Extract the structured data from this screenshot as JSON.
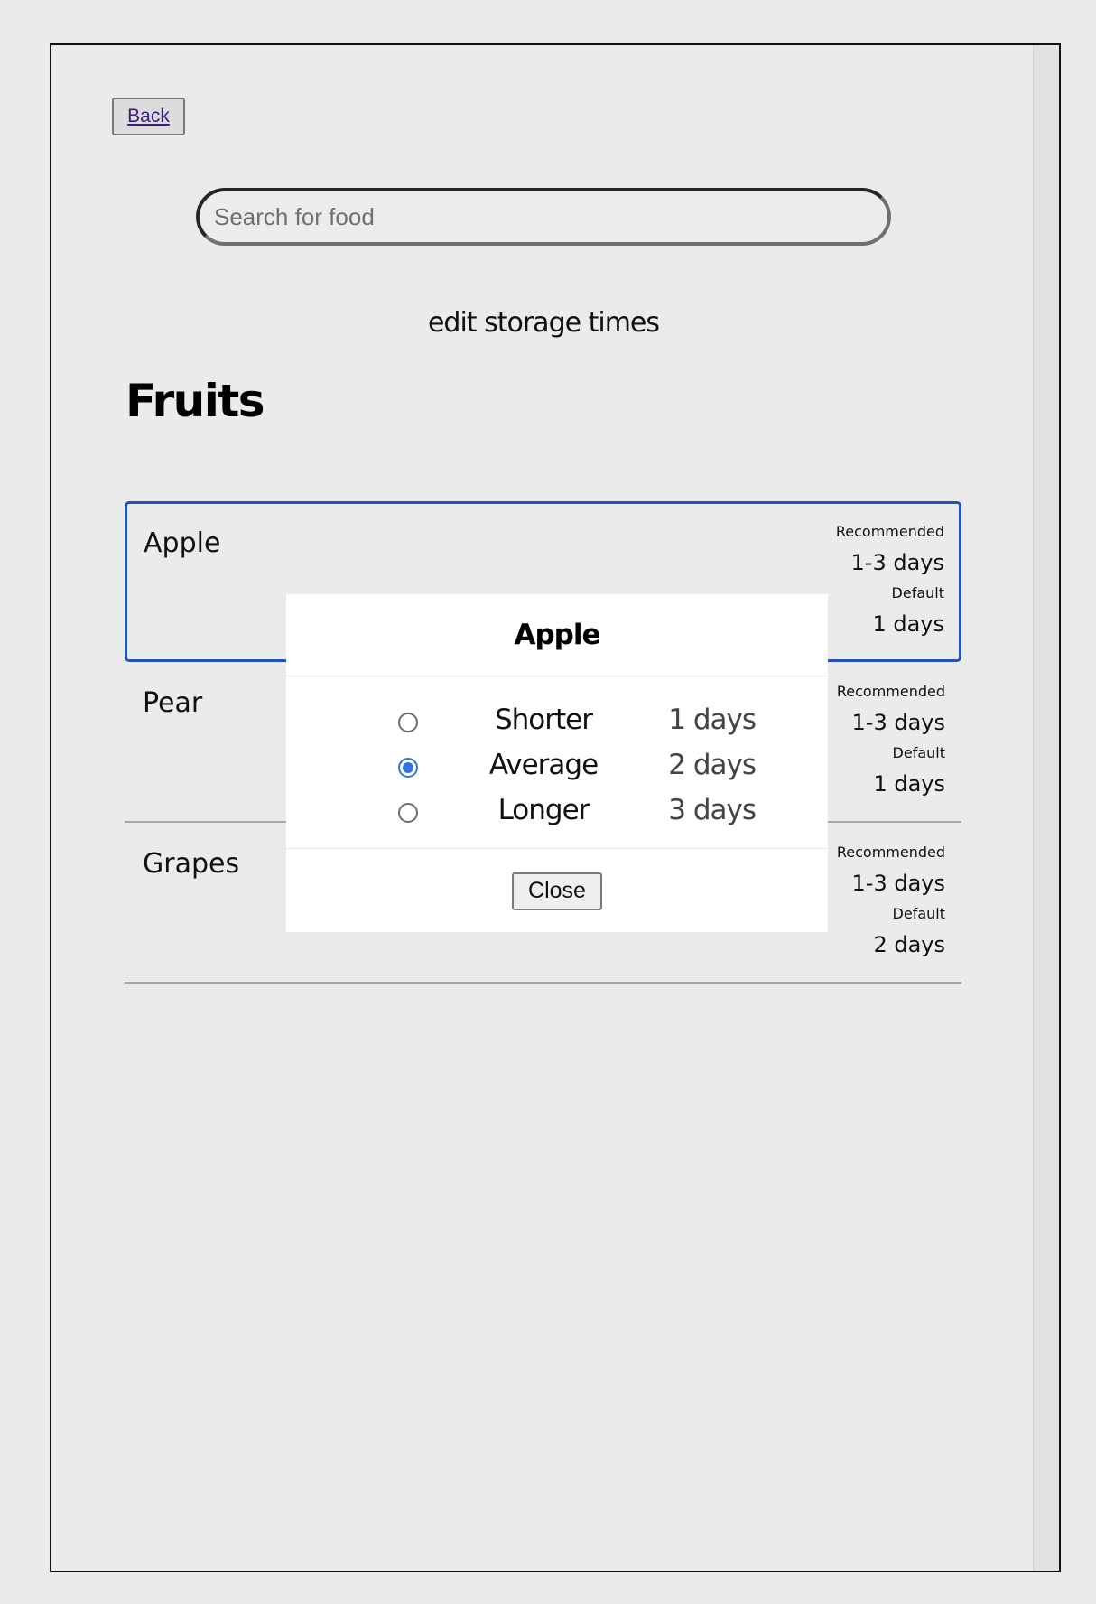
{
  "header": {
    "back_label": "Back",
    "search_placeholder": "Search for food",
    "subtitle": "edit storage times"
  },
  "category": {
    "title": "Fruits"
  },
  "foods": [
    {
      "name": "Apple",
      "recommended_label": "Recommended",
      "recommended_value": "1-3 days",
      "default_label": "Default",
      "default_value": "1 days",
      "selected": true
    },
    {
      "name": "Pear",
      "recommended_label": "Recommended",
      "recommended_value": "1-3 days",
      "default_label": "Default",
      "default_value": "1 days",
      "selected": false
    },
    {
      "name": "Grapes",
      "recommended_label": "Recommended",
      "recommended_value": "1-3 days",
      "default_label": "Default",
      "default_value": "2 days",
      "selected": false
    }
  ],
  "modal": {
    "title": "Apple",
    "options": [
      {
        "label": "Shorter",
        "days": "1 days",
        "checked": false
      },
      {
        "label": "Average",
        "days": "2 days",
        "checked": true
      },
      {
        "label": "Longer",
        "days": "3 days",
        "checked": false
      }
    ],
    "close_label": "Close"
  },
  "colors": {
    "selected_border": "#2254b8",
    "radio_accent": "#2f74e0",
    "page_background": "#ebebeb"
  }
}
